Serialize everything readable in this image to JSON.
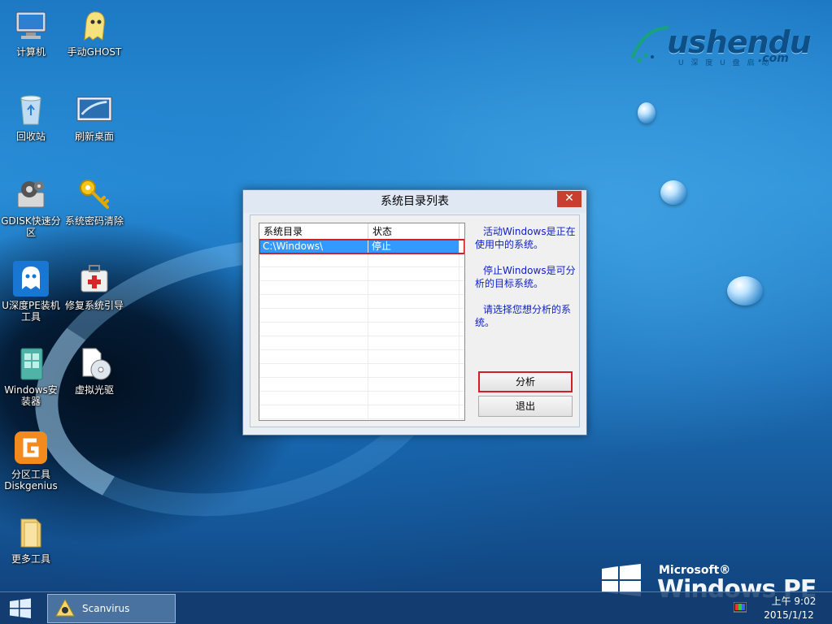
{
  "desktop": {
    "icons": [
      {
        "label": "计算机"
      },
      {
        "label": "手动GHOST"
      },
      {
        "label": "回收站"
      },
      {
        "label": "刷新桌面"
      },
      {
        "label": "GDISK快速分区"
      },
      {
        "label": "系统密码清除"
      },
      {
        "label": "U深度PE装机工具"
      },
      {
        "label": "修复系统引导"
      },
      {
        "label": "Windows安装器"
      },
      {
        "label": "虚拟光驱"
      },
      {
        "label": "分区工具Diskgenius"
      },
      {
        "label": "更多工具"
      }
    ],
    "logo": {
      "text": "ushendu",
      "sub": "U 深 度 U 盘 启 动",
      "com": ".com"
    },
    "brand": {
      "microsoft": "Microsoft®",
      "windows": "Windows PE"
    }
  },
  "dialog": {
    "title": "系统目录列表",
    "close_label": "✕",
    "columns": [
      "系统目录",
      "状态"
    ],
    "rows": [
      {
        "dir": "C:\\Windows\\",
        "status": "停止"
      }
    ],
    "info": [
      "活动Windows是正在使用中的系统。",
      "停止Windows是可分析的目标系统。",
      "请选择您想分析的系统。"
    ],
    "analyze_label": "分析",
    "exit_label": "退出"
  },
  "taskbar": {
    "task_label": "Scanvirus",
    "time": "上午 9:02",
    "date": "2015/1/12"
  },
  "colors": {
    "accent_red": "#d22020",
    "selection_blue": "#3399ff",
    "info_text": "#1020c8"
  }
}
